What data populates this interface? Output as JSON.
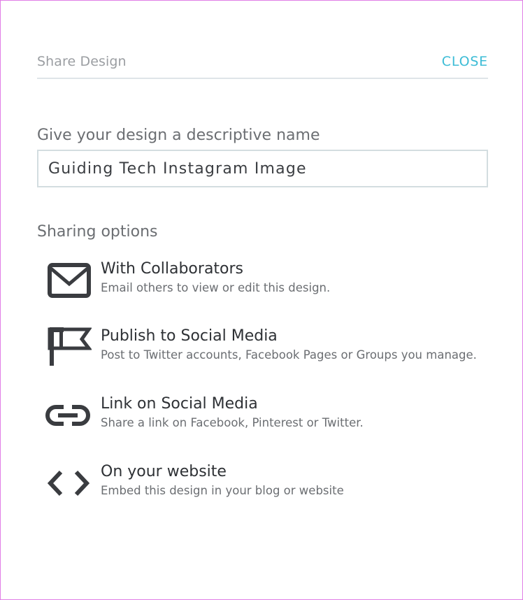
{
  "header": {
    "title": "Share Design",
    "close_label": "CLOSE"
  },
  "name_section": {
    "label": "Give your design a descriptive name",
    "input_value": "Guiding Tech Instagram Image"
  },
  "sharing": {
    "label": "Sharing options",
    "options": [
      {
        "icon": "envelope-icon",
        "title": "With Collaborators",
        "description": "Email others to view or edit this design."
      },
      {
        "icon": "flag-icon",
        "title": "Publish to Social Media",
        "description": "Post to Twitter accounts, Facebook Pages or Groups you manage."
      },
      {
        "icon": "link-icon",
        "title": "Link on Social Media",
        "description": "Share a link on Facebook, Pinterest or Twitter."
      },
      {
        "icon": "code-icon",
        "title": "On your website",
        "description": "Embed this design in your blog or website"
      }
    ]
  },
  "colors": {
    "accent": "#3cbcd6",
    "icon": "#3a3c40",
    "divider": "#dfe5e8",
    "frame_border": "#e07ee6"
  }
}
